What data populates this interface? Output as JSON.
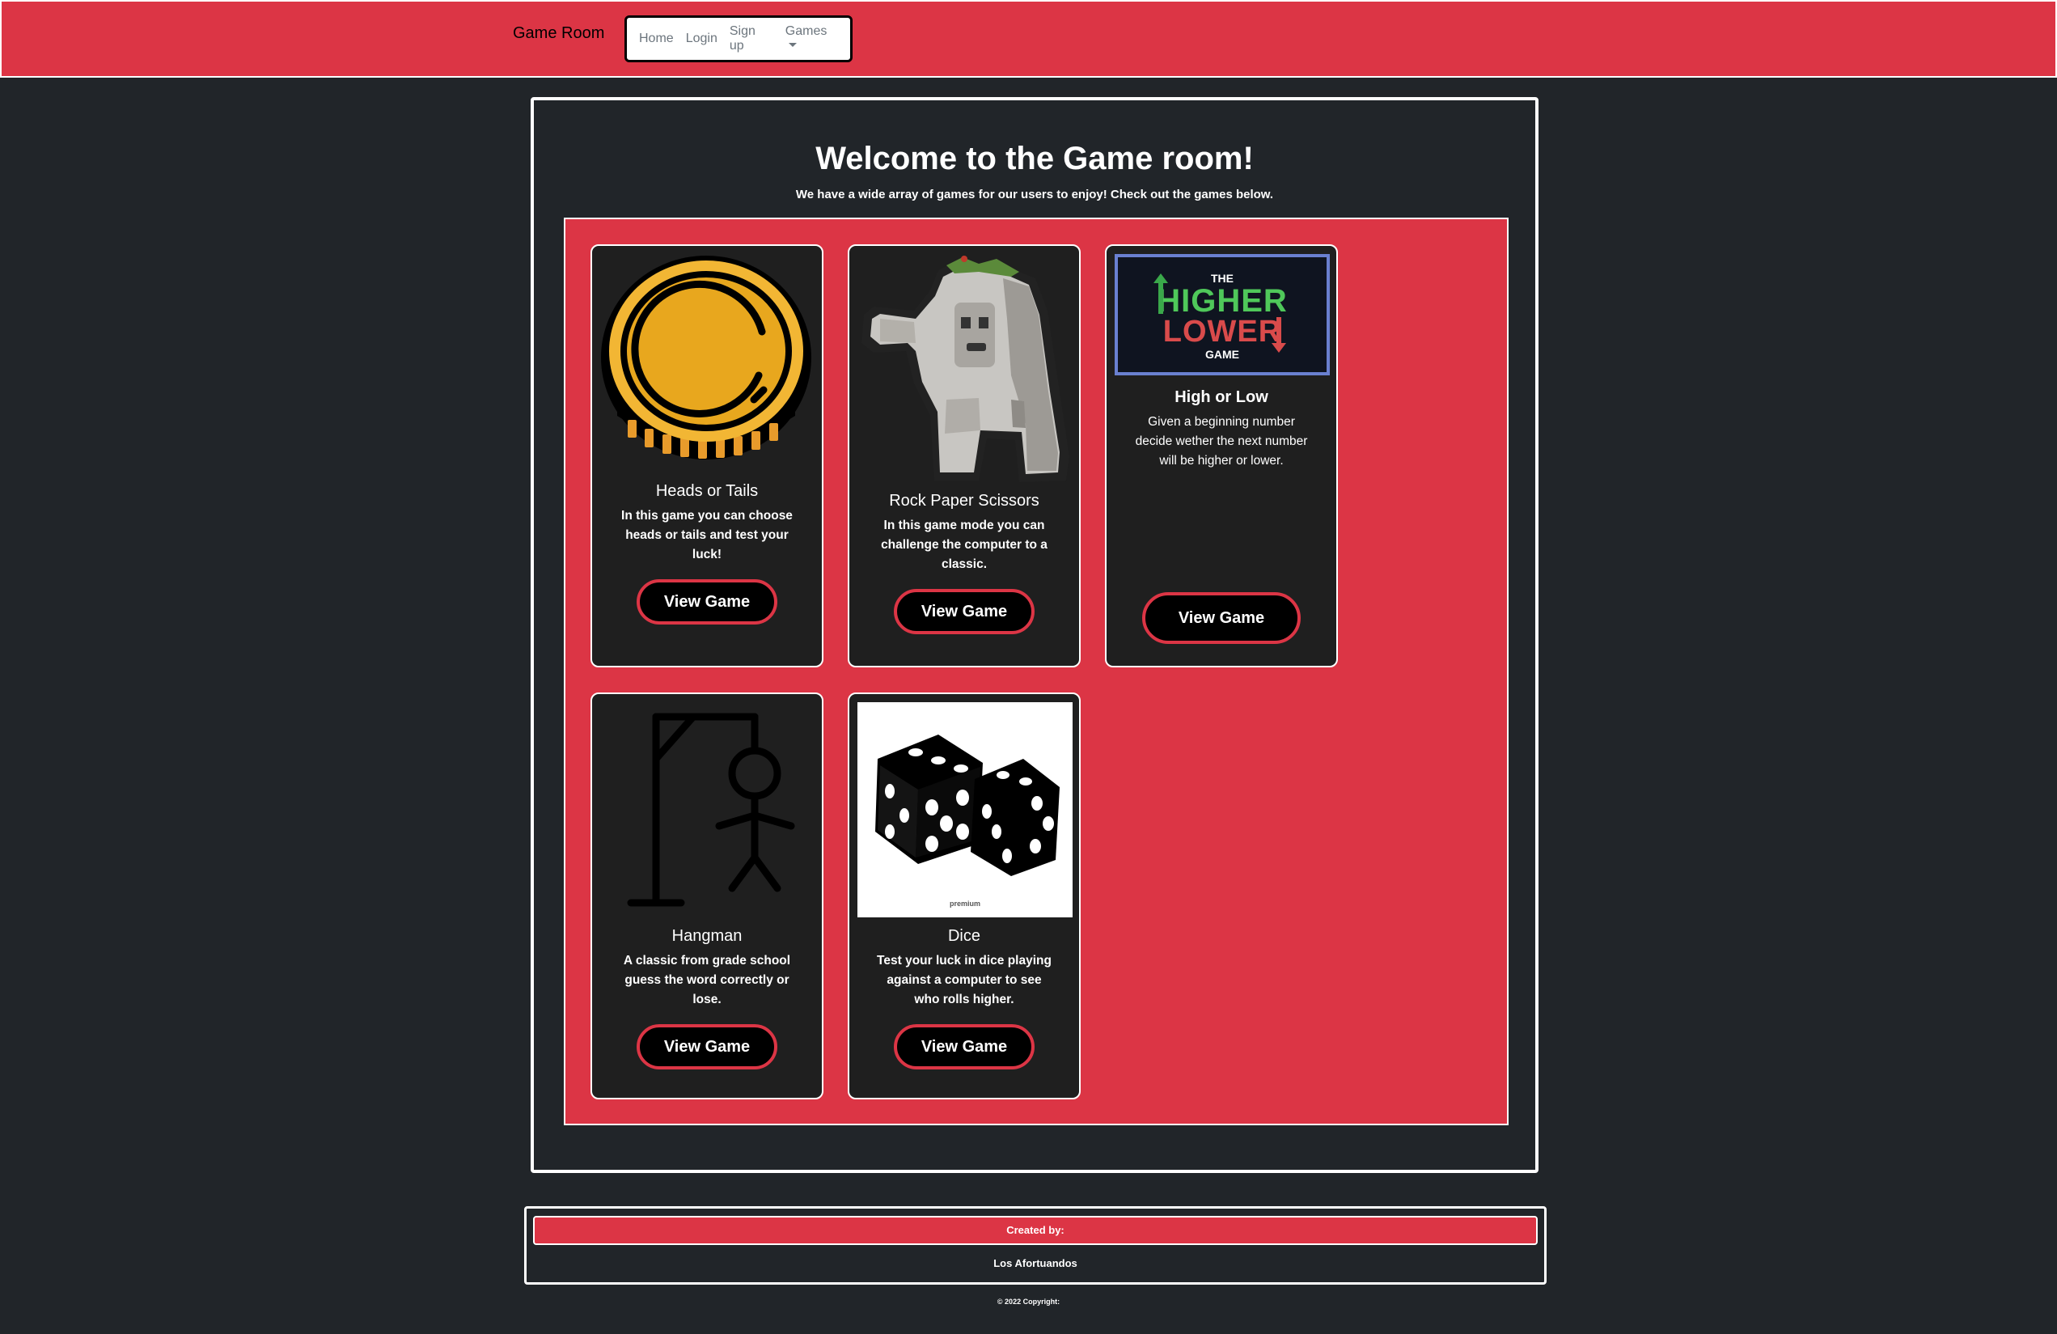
{
  "navbar": {
    "brand": "Game Room",
    "links": {
      "home": "Home",
      "login": "Login",
      "signup": "Sign up",
      "games": "Games"
    }
  },
  "main": {
    "title": "Welcome to the Game room!",
    "subtitle": "We have a wide array of games for our users to enjoy! Check out the games below."
  },
  "cards": [
    {
      "title": "Heads or Tails",
      "description": "In this game you can choose heads or tails and test your luck!",
      "button": "View Game"
    },
    {
      "title": "Rock Paper Scissors",
      "description": "In this game mode you can challenge the computer to a classic.",
      "button": "View Game"
    },
    {
      "title": "High or Low",
      "description": "Given a beginning number decide wether the next number will be higher or lower.",
      "button": "View Game",
      "image_text": {
        "the": "THE",
        "higher": "HIGHER",
        "lower": "LOWER",
        "game": "GAME"
      }
    },
    {
      "title": "Hangman",
      "description": "A classic from grade school guess the word correctly or lose.",
      "button": "View Game"
    },
    {
      "title": "Dice",
      "description": "Test your luck in dice playing against a computer to see who rolls higher.",
      "button": "View Game",
      "image_text": {
        "watermark": "premium"
      }
    }
  ],
  "footer": {
    "created_by": "Created by:",
    "team": "Los Afortuandos",
    "copyright": "© 2022 Copyright:"
  },
  "colors": {
    "accent": "#dc3545",
    "background": "#212529",
    "card": "#1f1f1f",
    "coin": "#e8a71e"
  },
  "icons": {
    "coin": "coin-icon",
    "golem": "rock-golem-icon",
    "hangman": "hangman-icon",
    "dice": "dice-icon"
  }
}
